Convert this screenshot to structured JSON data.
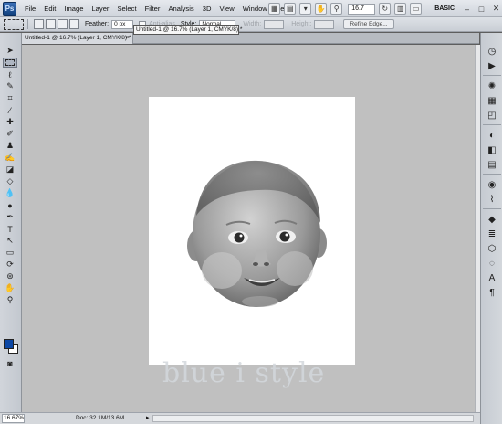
{
  "app": {
    "logo_text": "Ps"
  },
  "menu": [
    "File",
    "Edit",
    "Image",
    "Layer",
    "Select",
    "Filter",
    "Analysis",
    "3D",
    "View",
    "Window",
    "Help"
  ],
  "menu_right": {
    "zoom": "16.7",
    "workspace": "BASIC"
  },
  "options": {
    "feather_label": "Feather:",
    "feather_value": "0 px",
    "antialias_label": "Anti-alias",
    "style_label": "Style:",
    "style_value": "Normal",
    "width_label": "Width:",
    "height_label": "Height:",
    "refine_label": "Refine Edge..."
  },
  "document": {
    "tab_label": "Untitled-1 @ 16.7% (Layer 1, CMYK/8) *",
    "tooltip": "Untitled-1 @ 16.7% (Layer 1, CMYK/8) *",
    "close_glyph": "×"
  },
  "watermark": "blue i style",
  "status": {
    "zoom": "16.67%",
    "doc": "Doc: 32.1M/13.6M",
    "arrow": "▸"
  },
  "icons": {
    "tools": [
      "move-icon",
      "marquee-icon",
      "lasso-icon",
      "quick-select-icon",
      "crop-icon",
      "eyedropper-icon",
      "healing-icon",
      "brush-icon",
      "stamp-icon",
      "history-brush-icon",
      "eraser-icon",
      "bucket-icon",
      "blur-icon",
      "dodge-icon",
      "pen-icon",
      "type-icon",
      "path-select-icon",
      "shape-icon",
      "3d-rotate-icon",
      "3d-orbit-icon",
      "hand-icon",
      "zoom-icon"
    ],
    "dock": [
      "history-icon",
      "actions-icon",
      "color-icon",
      "swatches-icon",
      "styles-icon",
      "adjustments-icon",
      "masks-icon",
      "layers-icon",
      "channels-icon",
      "paths-icon",
      "character-icon",
      "paragraph-icon"
    ]
  },
  "colors": {
    "foreground": "#0b47a5",
    "background": "#ffffff",
    "canvas_bg": "#c0c0c0"
  }
}
